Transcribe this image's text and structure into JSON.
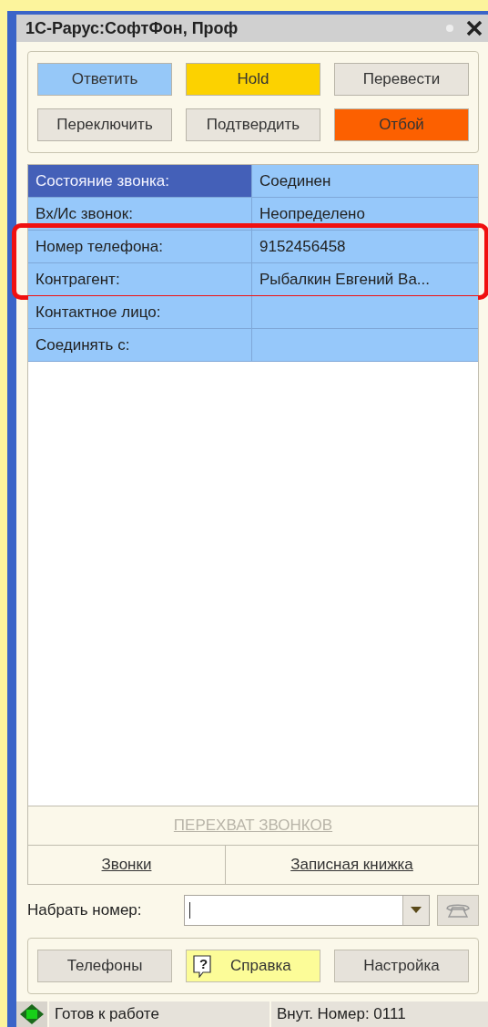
{
  "window": {
    "title": "1С-Рарус:СофтФон, Проф"
  },
  "call_buttons": [
    {
      "label": "Ответить",
      "color": "#96c8f8"
    },
    {
      "label": "Hold",
      "color": "#fcd200"
    },
    {
      "label": "Перевести",
      "color": "#e8e4dc"
    },
    {
      "label": "Переключить",
      "color": "#e8e4dc"
    },
    {
      "label": "Подтвердить",
      "color": "#e8e4dc"
    },
    {
      "label": "Отбой",
      "color": "#fc6000"
    }
  ],
  "info_rows": [
    {
      "label": "Состояние звонка:",
      "value": "Соединен",
      "selected": true,
      "highlighted": false
    },
    {
      "label": "Вх/Ис звонок:",
      "value": "Неопределено",
      "selected": false,
      "highlighted": false
    },
    {
      "label": "Номер телефона:",
      "value": "9152456458",
      "selected": false,
      "highlighted": true
    },
    {
      "label": "Контрагент:",
      "value": "Рыбалкин Евгений Ва...",
      "selected": false,
      "highlighted": true
    },
    {
      "label": "Контактное лицо:",
      "selected": false,
      "highlighted": false
    },
    {
      "label": "Соединять с:",
      "selected": false,
      "highlighted": false
    }
  ],
  "intercept_link": {
    "label": "ПЕРЕХВАТ ЗВОНКОВ",
    "disabled": true
  },
  "nav_links": [
    "Звонки",
    "Записная книжка"
  ],
  "dial": {
    "label": "Набрать номер:"
  },
  "bottom_buttons": [
    {
      "label": "Телефоны",
      "kind": "plain"
    },
    {
      "label": "Справка",
      "kind": "help",
      "icon": "?"
    },
    {
      "label": "Настройка",
      "kind": "plain"
    }
  ],
  "status_bar": {
    "status": "Готов к работе",
    "extension": "Внут. Номер: 0111"
  }
}
